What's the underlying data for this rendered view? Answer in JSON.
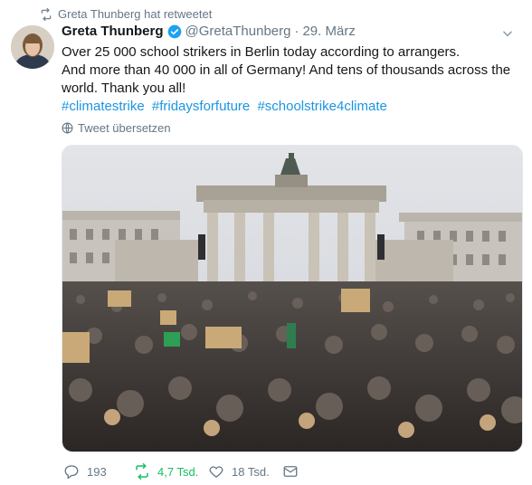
{
  "retweet_notice": "Greta Thunberg hat retweetet",
  "tweet": {
    "author_name": "Greta Thunberg",
    "handle": "@GretaThunberg",
    "separator": "·",
    "date": "29. März",
    "lines": [
      "Over 25 000 school strikers in Berlin today according to arrangers.",
      "And more than 40 000 in all of Germany! And tens of thousands across the world. Thank you all!"
    ],
    "hashtags": [
      "#climatestrike",
      "#fridaysforfuture",
      "#schoolstrike4climate"
    ],
    "translate_label": "Tweet übersetzen"
  },
  "actions": {
    "replies": "193",
    "retweets": "4,7 Tsd.",
    "likes": "18 Tsd."
  },
  "colors": {
    "link": "#1b95e0",
    "muted": "#657786",
    "retweet_active": "#17bf63"
  },
  "icons": [
    "retweet-icon",
    "verified-icon",
    "chevron-down-icon",
    "globe-icon",
    "reply-icon",
    "like-icon",
    "message-icon"
  ]
}
